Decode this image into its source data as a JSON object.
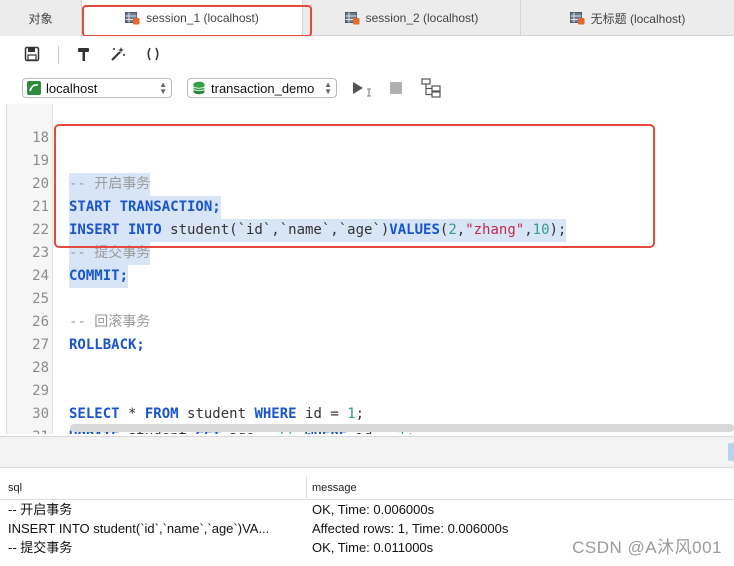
{
  "tabs": {
    "objects": "对象",
    "session1": "session_1 (localhost)",
    "session2": "session_2 (localhost)",
    "untitled": "无标题 (localhost)"
  },
  "toolbar": {
    "icons": [
      "save-icon",
      "hammer-icon",
      "magic-wand-icon",
      "parentheses-icon"
    ],
    "connection": "localhost",
    "database": "transaction_demo"
  },
  "editor": {
    "lines": [
      {
        "n": "18",
        "text": ""
      },
      {
        "n": "19",
        "text": "-- 开启事务"
      },
      {
        "n": "20",
        "text": "START TRANSACTION;"
      },
      {
        "n": "21",
        "text": "INSERT INTO student(`id`,`name`,`age`)VALUES(2,\"zhang\",10);"
      },
      {
        "n": "22",
        "text": "-- 提交事务"
      },
      {
        "n": "23",
        "text": "COMMIT;"
      },
      {
        "n": "24",
        "text": ""
      },
      {
        "n": "25",
        "text": "-- 回滚事务"
      },
      {
        "n": "26",
        "text": "ROLLBACK;"
      },
      {
        "n": "27",
        "text": ""
      },
      {
        "n": "28",
        "text": ""
      },
      {
        "n": "29",
        "text": "SELECT * FROM student WHERE id = 1;"
      },
      {
        "n": "30",
        "text": "UPDATE student SET age = 65 WHERE id = 1;"
      },
      {
        "n": "31",
        "text": ""
      }
    ]
  },
  "results": {
    "columns": [
      "sql",
      "message"
    ],
    "rows": [
      [
        "-- 开启事务",
        "OK, Time: 0.006000s"
      ],
      [
        "INSERT INTO student(`id`,`name`,`age`)VA...",
        "Affected rows: 1, Time: 0.006000s"
      ],
      [
        "-- 提交事务",
        "OK, Time: 0.011000s"
      ]
    ]
  },
  "watermark": "CSDN @A沐风001",
  "colors": {
    "keyword": "#1a55cc",
    "comment": "#9a9a9a",
    "string": "#c4284b",
    "number": "#2f9a8e",
    "selection": "#d7e5f7",
    "highlight_box": "#e34a3c"
  }
}
